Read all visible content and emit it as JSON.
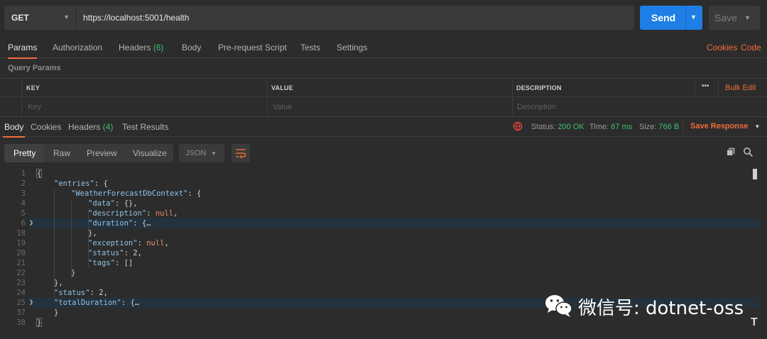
{
  "request": {
    "method": "GET",
    "url": "https://localhost:5001/health",
    "send_label": "Send",
    "save_label": "Save"
  },
  "request_tabs": [
    {
      "label": "Params",
      "active": true
    },
    {
      "label": "Authorization"
    },
    {
      "label": "Headers",
      "count": "(6)"
    },
    {
      "label": "Body"
    },
    {
      "label": "Pre-request Script"
    },
    {
      "label": "Tests"
    },
    {
      "label": "Settings"
    }
  ],
  "request_links": {
    "cookies": "Cookies",
    "code": "Code"
  },
  "query_params": {
    "title": "Query Params",
    "columns": [
      "KEY",
      "VALUE",
      "DESCRIPTION"
    ],
    "placeholders": [
      "Key",
      "Value",
      "Description"
    ],
    "more": "•••",
    "bulk_edit": "Bulk Edit"
  },
  "response_tabs": [
    {
      "label": "Body",
      "active": true
    },
    {
      "label": "Cookies"
    },
    {
      "label": "Headers",
      "count": "(4)"
    },
    {
      "label": "Test Results"
    }
  ],
  "response_status": {
    "status_label": "Status:",
    "status_value": "200 OK",
    "time_label": "Time:",
    "time_value": "67 ms",
    "size_label": "Size:",
    "size_value": "766 B",
    "save_response": "Save Response"
  },
  "viewer": {
    "modes": [
      "Pretty",
      "Raw",
      "Preview",
      "Visualize"
    ],
    "active_mode": "Pretty",
    "format": "JSON"
  },
  "code_lines": [
    {
      "n": "1",
      "indent": 0,
      "parts": [
        [
          "p",
          "{"
        ]
      ]
    },
    {
      "n": "2",
      "indent": 1,
      "parts": [
        [
          "k",
          "\"entries\""
        ],
        [
          "p",
          ": {"
        ]
      ]
    },
    {
      "n": "3",
      "indent": 2,
      "parts": [
        [
          "k",
          "\"WeatherForecastDbContext\""
        ],
        [
          "p",
          ": {"
        ]
      ]
    },
    {
      "n": "4",
      "indent": 3,
      "parts": [
        [
          "k",
          "\"data\""
        ],
        [
          "p",
          ": {},"
        ]
      ]
    },
    {
      "n": "5",
      "indent": 3,
      "parts": [
        [
          "k",
          "\"description\""
        ],
        [
          "p",
          ": "
        ],
        [
          "v",
          "null"
        ],
        [
          "p",
          ","
        ]
      ]
    },
    {
      "n": "6",
      "indent": 3,
      "fold": true,
      "parts": [
        [
          "k",
          "\"duration\""
        ],
        [
          "p",
          ": {…"
        ]
      ]
    },
    {
      "n": "18",
      "indent": 3,
      "parts": [
        [
          "p",
          "},"
        ]
      ]
    },
    {
      "n": "19",
      "indent": 3,
      "parts": [
        [
          "k",
          "\"exception\""
        ],
        [
          "p",
          ": "
        ],
        [
          "v",
          "null"
        ],
        [
          "p",
          ","
        ]
      ]
    },
    {
      "n": "20",
      "indent": 3,
      "parts": [
        [
          "k",
          "\"status\""
        ],
        [
          "p",
          ": 2,"
        ]
      ]
    },
    {
      "n": "21",
      "indent": 3,
      "parts": [
        [
          "k",
          "\"tags\""
        ],
        [
          "p",
          ": []"
        ]
      ]
    },
    {
      "n": "22",
      "indent": 2,
      "parts": [
        [
          "p",
          "}"
        ]
      ]
    },
    {
      "n": "23",
      "indent": 1,
      "parts": [
        [
          "p",
          "},"
        ]
      ]
    },
    {
      "n": "24",
      "indent": 1,
      "parts": [
        [
          "k",
          "\"status\""
        ],
        [
          "p",
          ": 2,"
        ]
      ]
    },
    {
      "n": "25",
      "indent": 1,
      "fold": true,
      "parts": [
        [
          "k",
          "\"totalDuration\""
        ],
        [
          "p",
          ": {…"
        ]
      ]
    },
    {
      "n": "37",
      "indent": 1,
      "parts": [
        [
          "p",
          "}"
        ]
      ]
    },
    {
      "n": "38",
      "indent": 0,
      "parts": [
        [
          "p",
          "}"
        ]
      ]
    }
  ],
  "watermark": {
    "text": "微信号: dotnet-oss"
  },
  "colors": {
    "accent": "#f26b3a",
    "primary": "#1f7ee6",
    "success": "#3fbf70"
  }
}
